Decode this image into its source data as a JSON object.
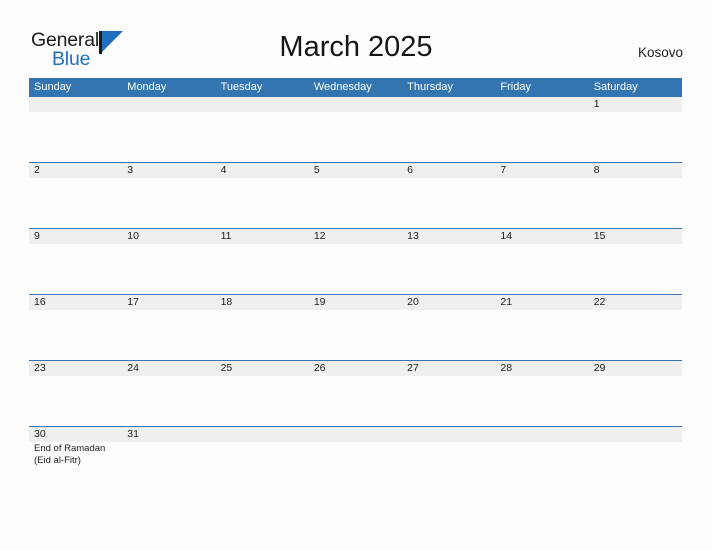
{
  "brand": {
    "word_one": "General",
    "word_two": "Blue",
    "flag_icon": "general-blue-flag-icon",
    "colors": {
      "dark": "#1c1c1c",
      "blue": "#1f71c0"
    }
  },
  "header": {
    "title": "March 2025",
    "region": "Kosovo"
  },
  "calendar": {
    "accent_color": "#3275b0",
    "band_color": "#efefef",
    "day_names": [
      "Sunday",
      "Monday",
      "Tuesday",
      "Wednesday",
      "Thursday",
      "Friday",
      "Saturday"
    ],
    "weeks": [
      [
        {
          "day": ""
        },
        {
          "day": ""
        },
        {
          "day": ""
        },
        {
          "day": ""
        },
        {
          "day": ""
        },
        {
          "day": ""
        },
        {
          "day": "1"
        }
      ],
      [
        {
          "day": "2"
        },
        {
          "day": "3"
        },
        {
          "day": "4"
        },
        {
          "day": "5"
        },
        {
          "day": "6"
        },
        {
          "day": "7"
        },
        {
          "day": "8"
        }
      ],
      [
        {
          "day": "9"
        },
        {
          "day": "10"
        },
        {
          "day": "11"
        },
        {
          "day": "12"
        },
        {
          "day": "13"
        },
        {
          "day": "14"
        },
        {
          "day": "15"
        }
      ],
      [
        {
          "day": "16"
        },
        {
          "day": "17"
        },
        {
          "day": "18"
        },
        {
          "day": "19"
        },
        {
          "day": "20"
        },
        {
          "day": "21"
        },
        {
          "day": "22"
        }
      ],
      [
        {
          "day": "23"
        },
        {
          "day": "24"
        },
        {
          "day": "25"
        },
        {
          "day": "26"
        },
        {
          "day": "27"
        },
        {
          "day": "28"
        },
        {
          "day": "29"
        }
      ],
      [
        {
          "day": "30",
          "events": [
            "End of Ramadan",
            "(Eid al-Fitr)"
          ]
        },
        {
          "day": "31"
        },
        {
          "day": ""
        },
        {
          "day": ""
        },
        {
          "day": ""
        },
        {
          "day": ""
        },
        {
          "day": ""
        }
      ]
    ]
  }
}
